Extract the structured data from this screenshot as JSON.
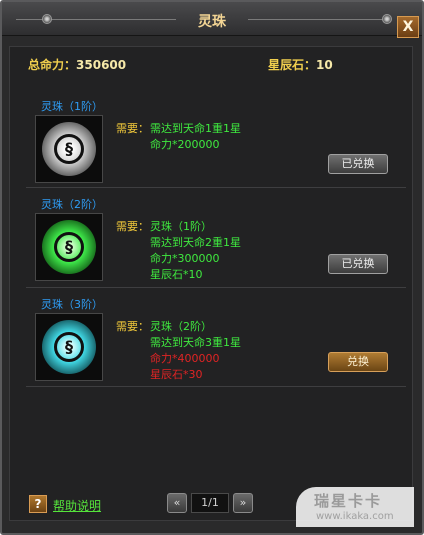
{
  "window": {
    "title": "灵珠",
    "close_label": "X"
  },
  "stats": {
    "power_label": "总命力：",
    "power_value": "350600",
    "stone_label": "星辰石：",
    "stone_value": "10"
  },
  "orbs": [
    {
      "title": "灵珠（1阶）",
      "need_label": "需要：",
      "requirements": [
        "需达到天命1重1星",
        "命力*200000"
      ],
      "button": "已兑换",
      "color": "#c9c9c9"
    },
    {
      "title": "灵珠（2阶）",
      "need_label": "需要：",
      "requirements": [
        "灵珠（1阶）",
        "需达到天命2重1星",
        "命力*300000",
        "星辰石*10"
      ],
      "button": "已兑换",
      "color": "#3fe94a"
    },
    {
      "title": "灵珠（3阶）",
      "need_label": "需要：",
      "requirements": [
        "灵珠（2阶）",
        "需达到天命3重1星",
        "命力*400000",
        "星辰石*30"
      ],
      "button": "兑换",
      "color": "#41d8e4"
    }
  ],
  "footer": {
    "help_icon": "?",
    "help_label": "帮助说明",
    "prev_label": "«",
    "next_label": "»",
    "page": "1/1"
  },
  "watermark": {
    "brand": "瑞星卡卡",
    "url": "www.ikaka.com"
  }
}
